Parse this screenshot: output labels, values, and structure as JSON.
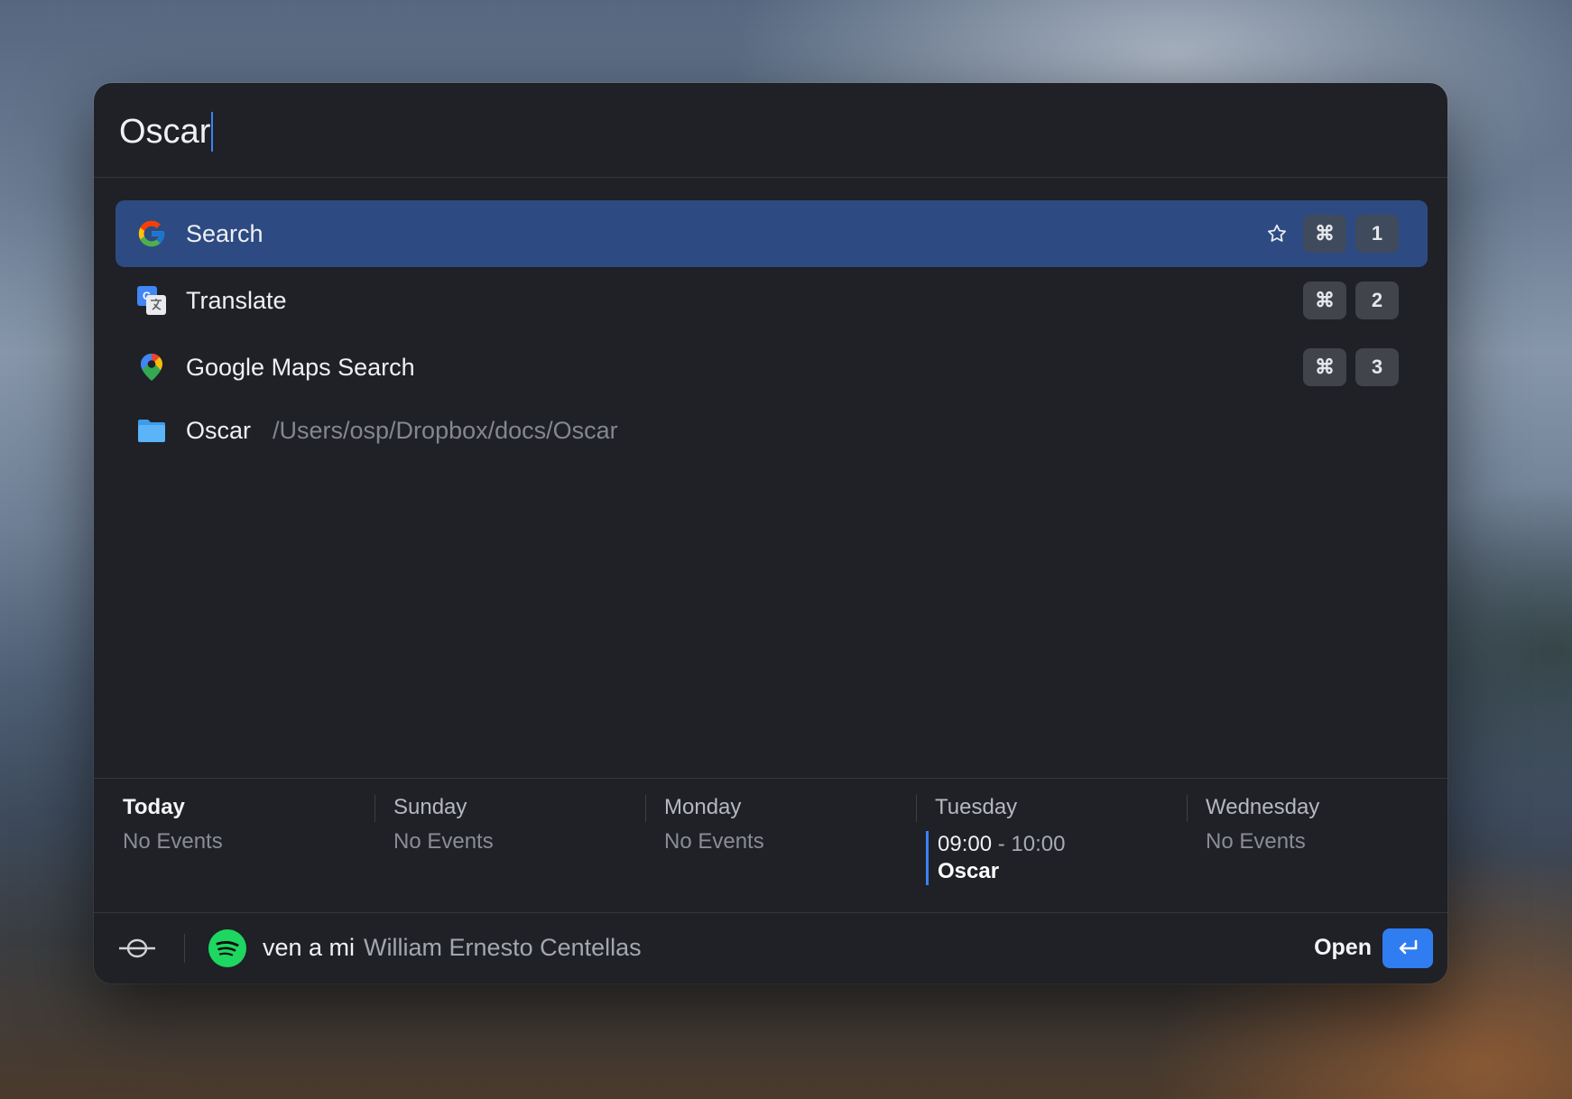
{
  "search": {
    "query": "Oscar"
  },
  "results": [
    {
      "label": "Search",
      "icon": "google-icon",
      "selected": true,
      "shortcut_mod": "⌘",
      "shortcut_num": "1"
    },
    {
      "label": "Translate",
      "icon": "google-translate-icon",
      "shortcut_mod": "⌘",
      "shortcut_num": "2"
    },
    {
      "label": "Google Maps Search",
      "icon": "google-maps-icon",
      "shortcut_mod": "⌘",
      "shortcut_num": "3"
    },
    {
      "label": "Oscar",
      "icon": "folder-icon",
      "path": "/Users/osp/Dropbox/docs/Oscar"
    }
  ],
  "calendar": {
    "days": [
      {
        "name": "Today",
        "status": "No Events"
      },
      {
        "name": "Sunday",
        "status": "No Events"
      },
      {
        "name": "Monday",
        "status": "No Events"
      },
      {
        "name": "Tuesday",
        "event": {
          "start": "09:00",
          "separator": "-",
          "end": "10:00",
          "title": "Oscar"
        }
      },
      {
        "name": "Wednesday",
        "status": "No Events"
      }
    ]
  },
  "footer": {
    "now_playing": {
      "track": "ven a mi",
      "artist": "William Ernesto Centellas"
    },
    "action_label": "Open"
  },
  "colors": {
    "accent": "#3b82f6",
    "selected_row": "#2d4b82",
    "window_bg": "#1f2126",
    "spotify_green": "#1ed760"
  }
}
